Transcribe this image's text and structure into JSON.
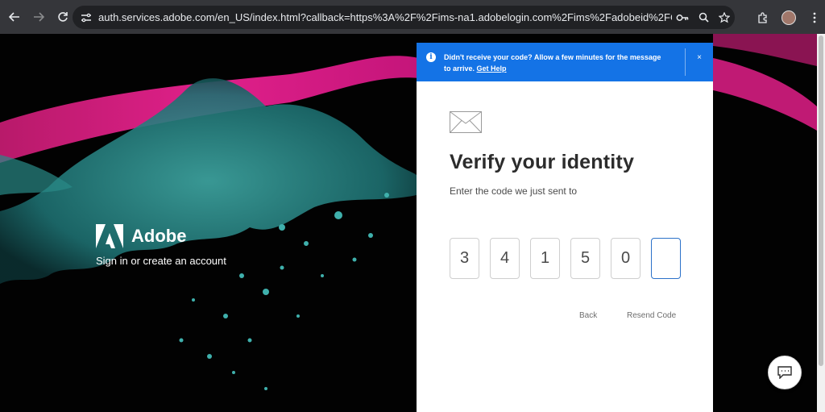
{
  "browser": {
    "url": "auth.services.adobe.com/en_US/index.html?callback=https%3A%2F%2Fims-na1.adobelogin.com%2Fims%2Fadobeid%2FCCHomeWeb1%2FA..."
  },
  "brand": {
    "name": "Adobe",
    "tagline": "Sign in or create an account"
  },
  "banner": {
    "message": "Didn't receive your code? Allow a few minutes for the message to arrive.",
    "help_link": "Get Help",
    "close_label": "×"
  },
  "verify": {
    "title": "Verify your identity",
    "subtitle": "Enter the code we just sent to",
    "code_digits": [
      "3",
      "4",
      "1",
      "5",
      "0",
      ""
    ],
    "back_label": "Back",
    "resend_label": "Resend Code"
  },
  "colors": {
    "accent": "#1473e6",
    "background": "#020202"
  }
}
